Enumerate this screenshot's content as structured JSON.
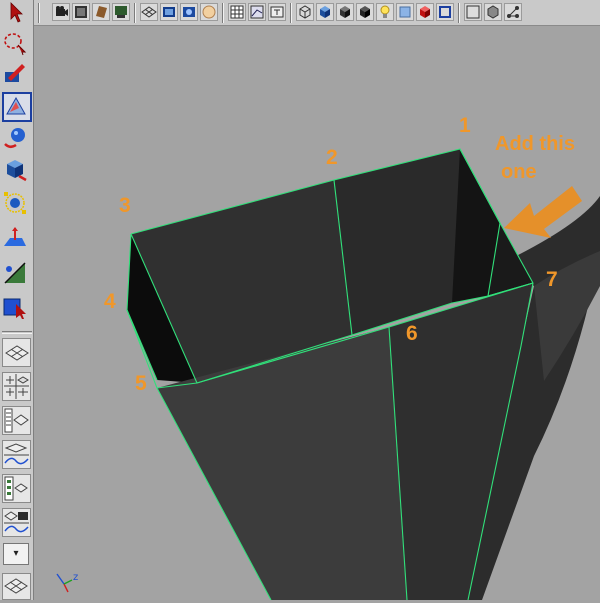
{
  "toolbar": {
    "icons": [
      "camera-icon",
      "film-icon",
      "book-icon",
      "render-settings-icon",
      "grid-icon",
      "panel-layout-icon",
      "disk-icon",
      "sphere-light-icon",
      "checker-icon",
      "uv-icon",
      "text-icon",
      "wireframe-cube-icon",
      "shaded-cube-icon",
      "smooth-shade-icon",
      "dark-cube-icon",
      "bulb-icon",
      "blue-cube-icon",
      "red-cube-icon",
      "frame-icon",
      "box-mode-icon",
      "grey-box-icon",
      "hypergraph-icon"
    ]
  },
  "toolbox": {
    "tools": [
      "select-icon",
      "lasso-icon",
      "paint-select-icon",
      "move-icon",
      "rotate-icon",
      "scale-icon",
      "universal-manip-icon",
      "soft-mod-icon",
      "show-manip-icon",
      "last-tool-icon"
    ],
    "layouts": [
      "single-perspective-layout-icon",
      "four-view-layout-icon",
      "outliner-persp-layout-icon",
      "persp-graph-layout-icon",
      "hypershade-layout-icon",
      "render-layout-icon",
      "dope-sheet-layout-icon"
    ],
    "dropdown_label": "▾"
  },
  "annotations": {
    "labels": [
      "1",
      "2",
      "3",
      "4",
      "5",
      "6",
      "7"
    ],
    "note_line1": "Add this",
    "note_line2": "one"
  },
  "axis": {
    "z": "z",
    "colors": {
      "x": "#d02020",
      "y": "#20a020",
      "z": "#2050d0"
    }
  },
  "colors": {
    "annotation": "#f0972a",
    "edge": "#31e07a",
    "viewport": "#a3a3a3"
  }
}
